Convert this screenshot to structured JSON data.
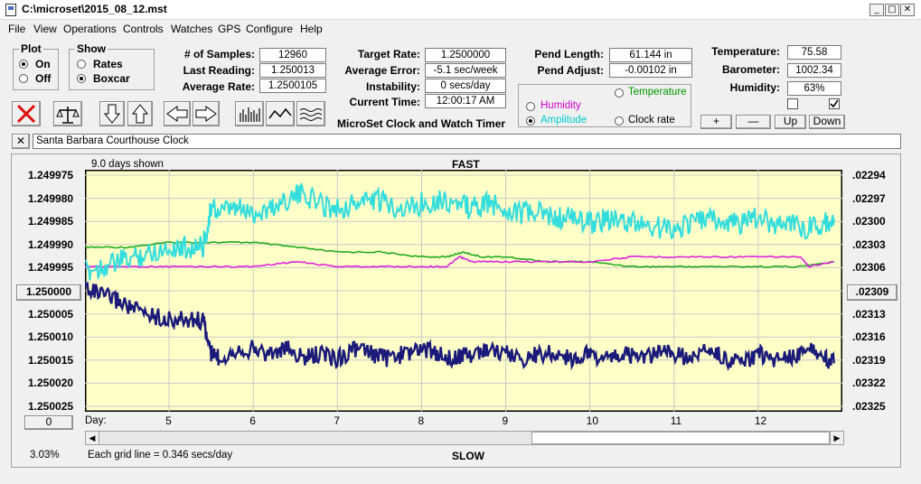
{
  "window": {
    "title": "C:\\microset\\2015_08_12.mst"
  },
  "menu": [
    "File",
    "View",
    "Operations",
    "Controls",
    "Watches",
    "GPS",
    "Configure",
    "Help"
  ],
  "plot": {
    "title": "Plot",
    "options": [
      "On",
      "Off"
    ],
    "selected": "On"
  },
  "show": {
    "title": "Show",
    "options": [
      "Rates",
      "Boxcar"
    ],
    "selected": "Boxcar"
  },
  "stats1": [
    {
      "label": "# of Samples:",
      "value": "12960"
    },
    {
      "label": "Last Reading:",
      "value": "1.250013"
    },
    {
      "label": "Average Rate:",
      "value": "1.2500105"
    }
  ],
  "stats2": [
    {
      "label": "Target Rate:",
      "value": "1.2500000"
    },
    {
      "label": "Average Error:",
      "value": "-5.1 sec/week"
    },
    {
      "label": "Instability:",
      "value": "0 secs/day"
    },
    {
      "label": "Current Time:",
      "value": "12:00:17 AM"
    }
  ],
  "pend": [
    {
      "label": "Pend Length:",
      "value": "61.144 in"
    },
    {
      "label": "Pend Adjust:",
      "value": "-0.00102 in"
    }
  ],
  "env": [
    {
      "label": "Temperature:",
      "value": "75.58"
    },
    {
      "label": "Barometer:",
      "value": "1002.34"
    },
    {
      "label": "Humidity:",
      "value": "63%"
    }
  ],
  "aux": {
    "options": [
      {
        "label": "Temperature",
        "color": "#009900"
      },
      {
        "label": "Humidity",
        "color": "#cc00cc"
      },
      {
        "label": "Amplitude",
        "color": "#00cccc"
      },
      {
        "label": "Clock rate",
        "color": "#000000"
      }
    ],
    "selected": "Amplitude"
  },
  "env_buttons": [
    "+",
    "—",
    "Up",
    "Down"
  ],
  "subtitle": "MicroSet Clock and Watch Timer",
  "clock_name": "Santa Barbara Courthouse Clock",
  "close_x": "✕",
  "chart": {
    "days_shown": "9.0 days shown",
    "fast": "FAST",
    "slow": "SLOW",
    "grid_note": "Each grid line = 0.346 secs/day",
    "percent": "3.03%",
    "left_button": "1.250000",
    "right_button": ".02309",
    "bottom_button": "0",
    "day_label": "Day:"
  },
  "chart_data": {
    "type": "line",
    "x_ticks": [
      "5",
      "6",
      "7",
      "8",
      "9",
      "10",
      "11",
      "12"
    ],
    "y_left_ticks": [
      "1.249975",
      "1.249980",
      "1.249985",
      "1.249990",
      "1.249995",
      "1.250000",
      "1.250005",
      "1.250010",
      "1.250015",
      "1.250020",
      "1.250025"
    ],
    "y_right_ticks": [
      ".02294",
      ".02297",
      ".02300",
      ".02303",
      ".02306",
      ".02309",
      ".02313",
      ".02316",
      ".02319",
      ".02322",
      ".02325"
    ],
    "xlim": [
      4.0,
      13.0
    ],
    "ylim": [
      1.250025,
      1.249975
    ],
    "series": [
      {
        "key": "clock_rate",
        "color": "#1a1a7a",
        "x": [
          4.0,
          4.2,
          4.4,
          4.6,
          4.8,
          5.0,
          5.2,
          5.4,
          5.5,
          5.6,
          5.8,
          6.0,
          6.2,
          6.4,
          6.6,
          6.8,
          7.0,
          7.2,
          7.4,
          7.6,
          7.8,
          8.0,
          8.2,
          8.4,
          8.6,
          8.8,
          9.0,
          9.2,
          9.4,
          9.6,
          9.8,
          10.0,
          10.2,
          10.4,
          10.6,
          10.8,
          11.0,
          11.2,
          11.4,
          11.6,
          11.8,
          12.0,
          12.2,
          12.4,
          12.6,
          12.8,
          12.9
        ],
        "y": [
          1.249999,
          1.250001,
          1.250002,
          1.250004,
          1.250005,
          1.250006,
          1.250006,
          1.250006,
          1.250013,
          1.250014,
          1.250012,
          1.250012,
          1.250013,
          1.250012,
          1.250014,
          1.250013,
          1.250014,
          1.250012,
          1.250013,
          1.250014,
          1.250013,
          1.250012,
          1.250013,
          1.250014,
          1.250013,
          1.250012,
          1.250013,
          1.250014,
          1.250013,
          1.250013,
          1.250014,
          1.250013,
          1.250014,
          1.250013,
          1.250014,
          1.250013,
          1.250013,
          1.250014,
          1.250012,
          1.250014,
          1.250015,
          1.250013,
          1.250014,
          1.250014,
          1.250012,
          1.250014,
          1.250015
        ]
      },
      {
        "key": "amplitude",
        "color": "#33dddd",
        "x": [
          4.0,
          4.2,
          4.4,
          4.6,
          4.8,
          5.0,
          5.2,
          5.4,
          5.5,
          5.6,
          5.8,
          6.0,
          6.2,
          6.4,
          6.6,
          6.8,
          7.0,
          7.2,
          7.4,
          7.6,
          7.8,
          8.0,
          8.2,
          8.4,
          8.6,
          8.8,
          9.0,
          9.2,
          9.4,
          9.6,
          9.8,
          10.0,
          10.2,
          10.4,
          10.6,
          10.8,
          11.0,
          11.2,
          11.4,
          11.6,
          11.8,
          12.0,
          12.2,
          12.4,
          12.6,
          12.8,
          12.9
        ],
        "y": [
          1.249996,
          1.249995,
          1.249994,
          1.249993,
          1.249992,
          1.249991,
          1.249991,
          1.249991,
          1.249983,
          1.249984,
          1.249983,
          1.249984,
          1.249983,
          1.249981,
          1.24998,
          1.249982,
          1.249983,
          1.249982,
          1.249981,
          1.249982,
          1.249983,
          1.249982,
          1.249981,
          1.249982,
          1.249983,
          1.249982,
          1.249983,
          1.249984,
          1.249984,
          1.249985,
          1.249985,
          1.249986,
          1.249985,
          1.249986,
          1.249986,
          1.249987,
          1.249987,
          1.249986,
          1.249985,
          1.249986,
          1.249986,
          1.249985,
          1.249986,
          1.249986,
          1.249987,
          1.249986,
          1.249985
        ]
      },
      {
        "key": "temperature",
        "color": "#22aa22",
        "x": [
          4.0,
          4.5,
          5.0,
          5.5,
          6.0,
          6.5,
          7.0,
          7.5,
          8.0,
          8.3,
          8.5,
          8.7,
          9.0,
          9.5,
          10.0,
          10.5,
          11.0,
          11.5,
          12.0,
          12.5,
          12.9
        ],
        "y": [
          1.249991,
          1.249991,
          1.24999,
          1.24999,
          1.24999,
          1.249991,
          1.249992,
          1.249992,
          1.249993,
          1.249993,
          1.249992,
          1.249993,
          1.249993,
          1.249994,
          1.249994,
          1.249995,
          1.249995,
          1.249995,
          1.249995,
          1.249995,
          1.249994
        ]
      },
      {
        "key": "humidity",
        "color": "#dd22dd",
        "x": [
          4.0,
          4.5,
          5.0,
          5.5,
          6.0,
          6.5,
          7.0,
          7.5,
          8.0,
          8.3,
          8.45,
          8.6,
          9.0,
          9.5,
          10.0,
          10.5,
          11.0,
          11.5,
          12.0,
          12.5,
          12.6,
          12.9
        ],
        "y": [
          1.249995,
          1.249995,
          1.249995,
          1.249995,
          1.249995,
          1.249994,
          1.249995,
          1.249995,
          1.249995,
          1.249995,
          1.249993,
          1.249994,
          1.249994,
          1.249994,
          1.249994,
          1.249993,
          1.249993,
          1.249993,
          1.249993,
          1.249993,
          1.249995,
          1.249994
        ]
      }
    ]
  }
}
